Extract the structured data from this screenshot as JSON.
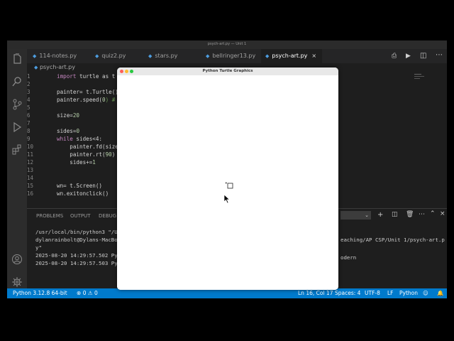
{
  "window": {
    "title": "psych-art.py — Unit 1"
  },
  "tabs": [
    {
      "label": "114-notes.py",
      "active": false
    },
    {
      "label": "quiz2.py",
      "active": false
    },
    {
      "label": "stars.py",
      "active": false
    },
    {
      "label": "bellringer13.py",
      "active": false
    },
    {
      "label": "psych-art.py",
      "active": true
    }
  ],
  "breadcrumb": "psych-art.py",
  "code": {
    "line_numbers": [
      "1",
      "2",
      "3",
      "4",
      "5",
      "6",
      "7",
      "8",
      "9",
      "10",
      "11",
      "12",
      "13",
      "14",
      "15",
      "16"
    ],
    "l1_kw": "import",
    "l1_rest": " turtle as t",
    "l3": "painter= t.Turtle()",
    "l4a": "painter.speed(",
    "l4n": "0",
    "l4b": ") #",
    "l6a": "size=",
    "l6n": "20",
    "l8a": "sides=",
    "l8n": "0",
    "l9_kw": "while",
    "l9_rest": " sides<4:",
    "l10": "    painter.fd(size",
    "l11a": "    painter.rt(",
    "l11n": "90",
    "l11b": ")",
    "l12a": "    sides+=",
    "l12n": "1",
    "l15": "wn= t.Screen()",
    "l16": "wn.exitonclick()"
  },
  "panel": {
    "tabs": [
      "PROBLEMS",
      "OUTPUT",
      "DEBUG C"
    ],
    "lines": [
      "/usr/local/bin/python3 \"/U",
      "dylanrainbolt@Dylans-MacBo",
      "y\"",
      "2025-08-20 14:29:57.502 Py",
      "2025-08-20 14:29:57.503 Py"
    ],
    "right_lines": [
      "eaching/AP CSP/Unit 1/psych-art.p",
      "odern"
    ]
  },
  "statusbar": {
    "python": "Python 3.12.8 64-bit",
    "errors": "0",
    "warnings": "0",
    "position": "Ln 16, Col 17",
    "spaces": "Spaces: 4",
    "encoding": "UTF-8",
    "eol": "LF",
    "language": "Python"
  },
  "turtle_window": {
    "title": "Python Turtle Graphics"
  },
  "colors": {
    "accent": "#007acc",
    "editor_bg": "#1e1e1e",
    "tab_bg": "#252526"
  }
}
